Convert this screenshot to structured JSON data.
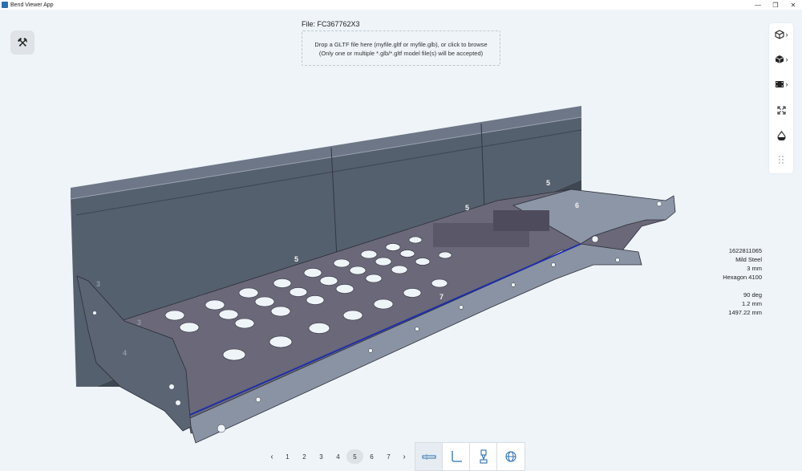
{
  "window": {
    "title": "Bend Viewer App",
    "controls": [
      "—",
      "❐",
      "✕"
    ]
  },
  "file": {
    "label": "File: FC367762X3"
  },
  "dropzone": {
    "line1": "Drop a GLTF file here (myfile.gltf or myfile.glb), or click to browse",
    "line2": "(Only one or multiple *.glb/*.gltf model file(s) will be accepted)"
  },
  "right_toolbar": {
    "items": [
      {
        "icon": "cube-outline-icon",
        "has_menu": true
      },
      {
        "icon": "cube-solid-icon",
        "has_menu": true
      },
      {
        "icon": "film-icon",
        "has_menu": true
      },
      {
        "icon": "fit-screen-icon",
        "has_menu": false
      },
      {
        "icon": "drop-icon",
        "has_menu": false
      },
      {
        "icon": "drag-handle-icon",
        "has_menu": false
      }
    ]
  },
  "part_info": {
    "id": "1622811065",
    "material": "Mild Steel",
    "thickness": "3 mm",
    "machine": "Hexagon 4100"
  },
  "bend_info": {
    "angle": "90 deg",
    "radius": "1.2 mm",
    "length": "1497.22 mm"
  },
  "bend_labels": [
    "5",
    "5",
    "6",
    "5",
    "7",
    "3",
    "3",
    "4"
  ],
  "pager": {
    "prev": "‹",
    "next": "›",
    "pages": [
      "1",
      "2",
      "3",
      "4",
      "5",
      "6",
      "7"
    ],
    "active_page": "5"
  },
  "view_tabs": [
    {
      "icon": "flat-view-icon",
      "active": true
    },
    {
      "icon": "bend-profile-icon",
      "active": false
    },
    {
      "icon": "tool-view-icon",
      "active": false
    },
    {
      "icon": "globe-view-icon",
      "active": false
    }
  ],
  "colors": {
    "background": "#eef4f8",
    "panel_dark": "#4f5866",
    "panel_mid": "#6b7585",
    "flange_light": "#8c96a6",
    "bend_line": "#1e2fa8"
  }
}
